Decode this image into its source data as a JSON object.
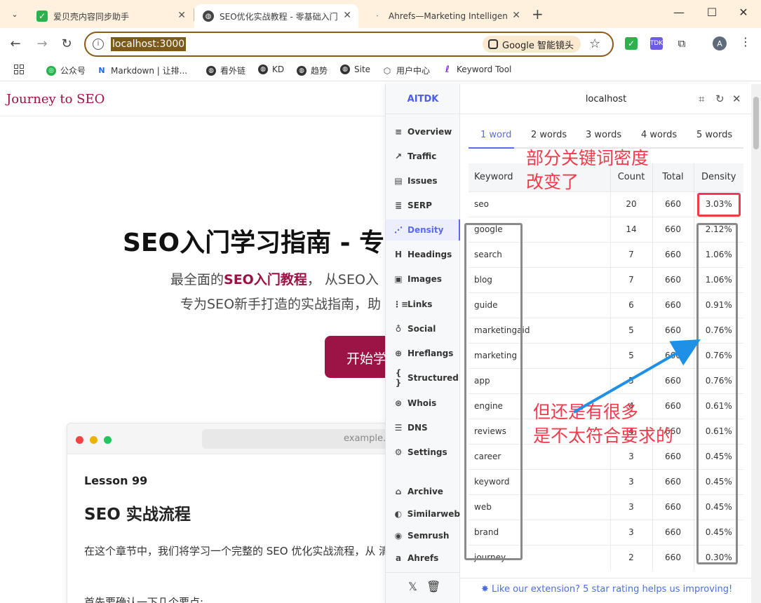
{
  "browser": {
    "tabs": [
      {
        "title": "爱贝壳内容同步助手"
      },
      {
        "title": "SEO优化实战教程 - 零基础入门"
      },
      {
        "title": "Ahrefs—Marketing Intelligence"
      }
    ],
    "url": "localhost:3000",
    "lens_label": "Google 智能镜头",
    "profile_initial": "A",
    "bookmarks": [
      "公众号",
      "Markdown | 让排...",
      "看外链",
      "KD",
      "趋势",
      "Site",
      "用户中心",
      "Keyword Tool"
    ]
  },
  "page": {
    "brand": "Journey to SEO",
    "hero_title": "SEO入门学习指南 - 专业",
    "hero_sub_prefix": "最全面的",
    "hero_sub_strong": "SEO入门教程",
    "hero_sub_suffix": "， 从SEO入",
    "hero_sub2": "专为SEO新手打造的实战指南，助",
    "cta": "开始学",
    "card": {
      "url": "example.",
      "lesson": "Lesson 99",
      "title": "SEO 实战流程",
      "paragraph": "在这个章节中，我们将学习一个完整的 SEO 优化实战流程，从 清晰的实践路径。",
      "paragraph2": "首先要确认一下几个要点:"
    }
  },
  "aitdk": {
    "logo": "AITDK",
    "host": "localhost",
    "nav": [
      {
        "label": "Overview",
        "icon": "≡"
      },
      {
        "label": "Traffic",
        "icon": "↗"
      },
      {
        "label": "Issues",
        "icon": "▤"
      },
      {
        "label": "SERP",
        "icon": "≣"
      },
      {
        "label": "Density",
        "icon": "⋰"
      },
      {
        "label": "Headings",
        "icon": "H"
      },
      {
        "label": "Images",
        "icon": "▣"
      },
      {
        "label": "Links",
        "icon": "⋮≡"
      },
      {
        "label": "Social",
        "icon": "♁"
      },
      {
        "label": "Hreflangs",
        "icon": "⊕"
      },
      {
        "label": "Structured",
        "icon": "{ }"
      },
      {
        "label": "Whois",
        "icon": "⊛"
      },
      {
        "label": "DNS",
        "icon": "☰"
      },
      {
        "label": "Settings",
        "icon": "⚙"
      },
      {
        "label": "Archive",
        "icon": "⌂"
      },
      {
        "label": "Similarweb",
        "icon": "◐"
      },
      {
        "label": "Semrush",
        "icon": "◉"
      },
      {
        "label": "Ahrefs",
        "icon": "a"
      }
    ],
    "word_tabs": [
      "1 word",
      "2 words",
      "3 words",
      "4 words",
      "5 words"
    ],
    "columns": [
      "Keyword",
      "Count",
      "Total",
      "Density"
    ],
    "rows": [
      {
        "keyword": "seo",
        "count": "20",
        "total": "660",
        "density": "3.03%"
      },
      {
        "keyword": "google",
        "count": "14",
        "total": "660",
        "density": "2.12%"
      },
      {
        "keyword": "search",
        "count": "7",
        "total": "660",
        "density": "1.06%"
      },
      {
        "keyword": "blog",
        "count": "7",
        "total": "660",
        "density": "1.06%"
      },
      {
        "keyword": "guide",
        "count": "6",
        "total": "660",
        "density": "0.91%"
      },
      {
        "keyword": "marketingaid",
        "count": "5",
        "total": "660",
        "density": "0.76%"
      },
      {
        "keyword": "marketing",
        "count": "5",
        "total": "660",
        "density": "0.76%"
      },
      {
        "keyword": "app",
        "count": "5",
        "total": "660",
        "density": "0.76%"
      },
      {
        "keyword": "engine",
        "count": "4",
        "total": "660",
        "density": "0.61%"
      },
      {
        "keyword": "reviews",
        "count": "4",
        "total": "660",
        "density": "0.61%"
      },
      {
        "keyword": "career",
        "count": "3",
        "total": "660",
        "density": "0.45%"
      },
      {
        "keyword": "keyword",
        "count": "3",
        "total": "660",
        "density": "0.45%"
      },
      {
        "keyword": "web",
        "count": "3",
        "total": "660",
        "density": "0.45%"
      },
      {
        "keyword": "brand",
        "count": "3",
        "total": "660",
        "density": "0.45%"
      },
      {
        "keyword": "journey",
        "count": "2",
        "total": "660",
        "density": "0.30%"
      }
    ],
    "footer": "Like our extension? 5 star rating helps us improving!"
  },
  "annotations": {
    "top_line1": "部分关键词密度",
    "top_line2": "改变了",
    "bottom_line1": "但还是有很多",
    "bottom_line2": "是不太符合要求的",
    "red": "#f03b4c",
    "gray": "#8a8a8a",
    "arrow": "#1e90e6"
  }
}
